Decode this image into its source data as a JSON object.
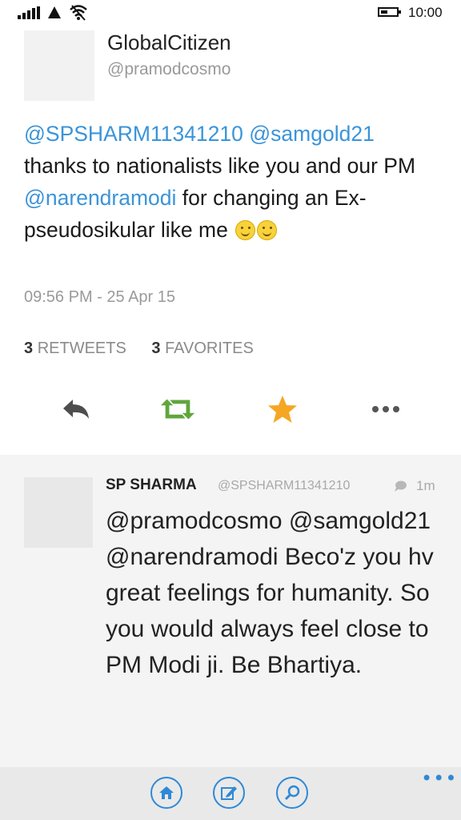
{
  "status_bar": {
    "time": "10:00",
    "battery_level": 0.45
  },
  "tweet": {
    "display_name": "GlobalCitizen",
    "handle": "@pramodcosmo",
    "mention_1": "@SPSHARM11341210",
    "mention_2": "@samgold21",
    "text_1": "thanks to  nationalists like you and our PM",
    "mention_3": "@narendramodi",
    "text_2": "for changing an Ex-pseudosikular like me",
    "timestamp": "09:56 PM - 25 Apr 15",
    "retweets_count": "3",
    "retweets_label": "RETWEETS",
    "favorites_count": "3",
    "favorites_label": "FAVORITES"
  },
  "actions": {
    "icons": [
      "reply-icon",
      "retweet-icon",
      "favorite-star-icon",
      "more-icon"
    ],
    "colors": {
      "reply": "#4d4d4d",
      "retweet": "#5fa63c",
      "favorite": "#f5a623",
      "more": "#555555"
    }
  },
  "reply": {
    "name": "SP SHARMA",
    "handle": "@SPSHARM11341210",
    "time": "1m",
    "text": "@pramodcosmo @samgold21 @narendramodi Beco'z you hv great feelings for humanity. So you would always feel close to PM Modi ji. Be Bhartiya."
  },
  "app_bar": {
    "buttons": [
      "home-icon",
      "compose-icon",
      "search-icon"
    ],
    "more": "•••",
    "accent": "#2f89d6"
  }
}
